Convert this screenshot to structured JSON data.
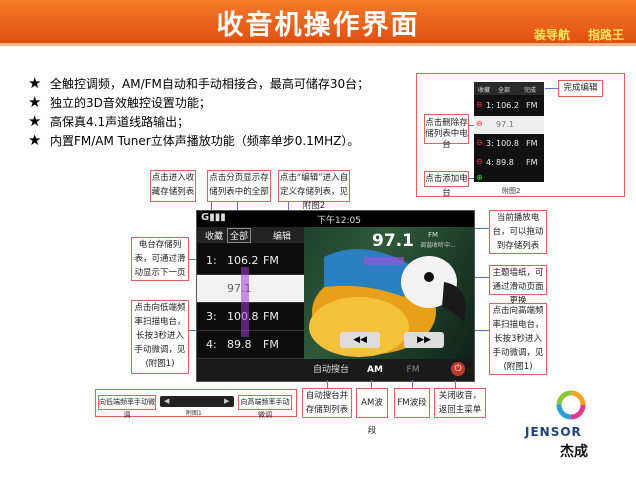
{
  "header": {
    "title": "收音机操作界面",
    "link1": "装导航",
    "link2": "指路王"
  },
  "features": [
    "全触控调频，AM/FM自动和手动相接合，最高可储存30台；",
    "独立的3D音效触控设置功能；",
    "高保真4.1声道线路输出；",
    "内置FM/AM Tuner立体声播放功能（频率单步0.1MHZ）。"
  ],
  "radio": {
    "top_tabs": [
      "收藏",
      "全部",
      "编辑"
    ],
    "time": "下午12:05",
    "current_freq": "97.1",
    "current_band": "FM",
    "current_info": "调谐收听中...",
    "presets": [
      {
        "num": "1:",
        "freq": "106.2",
        "band": "FM"
      },
      {
        "num": "",
        "freq": "97.1",
        "band": ""
      },
      {
        "num": "3:",
        "freq": "100.8",
        "band": "FM"
      },
      {
        "num": "4:",
        "freq": "89.8",
        "band": "FM"
      }
    ],
    "bottom_buttons": [
      "自动搜台",
      "AM",
      "FM"
    ],
    "seek_prev": "◀◀",
    "seek_next": "▶▶"
  },
  "annex2": {
    "label": "附图2",
    "done_edit": "完成编辑",
    "delete_hint": "点击删除存储列表中电台",
    "add_hint": "点击添加电台",
    "tabs": [
      "收藏",
      "全部",
      "完成"
    ],
    "rows": [
      {
        "num": "1:",
        "freq": "106.2",
        "band": "FM"
      },
      {
        "num": "",
        "freq": "97.1",
        "band": ""
      },
      {
        "num": "3:",
        "freq": "100.8",
        "band": "FM"
      },
      {
        "num": "4:",
        "freq": "89.8",
        "band": "FM"
      }
    ]
  },
  "annex1": {
    "label": "附图1",
    "left": "向低端频率手动微调",
    "right": "向高端频率手动微调"
  },
  "callouts": {
    "favorites": "点击进入收藏存储列表",
    "all": "点击分页显示存储列表中的全部",
    "edit": "点击“编辑”进入自定义存储列表，见 附图2",
    "station_list": "电台存储列表，可通过滑动显示下一页",
    "now_playing": "当前播放电台，可以拖动到存储列表",
    "wallpaper": "主题墙纸，可通过滑动页面更换",
    "seek_low": "点击向低端频率扫描电台，长按3秒进入手动微调，见(附图1)",
    "seek_high": "点击向高端频率扫描电台，长按3秒进入手动微调，见(附图1)",
    "auto_search": "自动搜台并存储到列表",
    "am_band": "AM波段",
    "fm_band": "FM波段",
    "close": "关闭收音，返回主菜单"
  },
  "logo": {
    "en": "JENSOR",
    "cn": "杰成"
  },
  "colors": {
    "header_orange": "#e85a12",
    "callout_border": "#e06060",
    "link_yellow": "#ffe65a"
  }
}
